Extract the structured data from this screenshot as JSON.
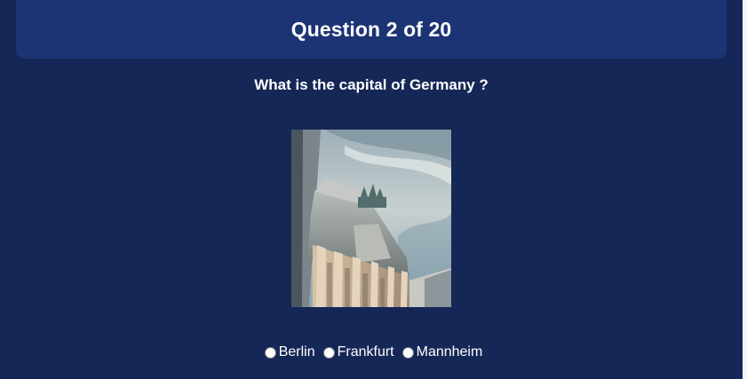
{
  "header": {
    "title": "Question 2 of 20"
  },
  "quiz": {
    "question": "What is the capital of Germany ?",
    "image_subject": "brandenburg-gate-photo",
    "options": [
      {
        "label": "Berlin",
        "selected": false
      },
      {
        "label": "Frankfurt",
        "selected": false
      },
      {
        "label": "Mannheim",
        "selected": false
      }
    ]
  },
  "colors": {
    "background": "#152756",
    "header": "#1c3474",
    "text": "#ffffff"
  }
}
